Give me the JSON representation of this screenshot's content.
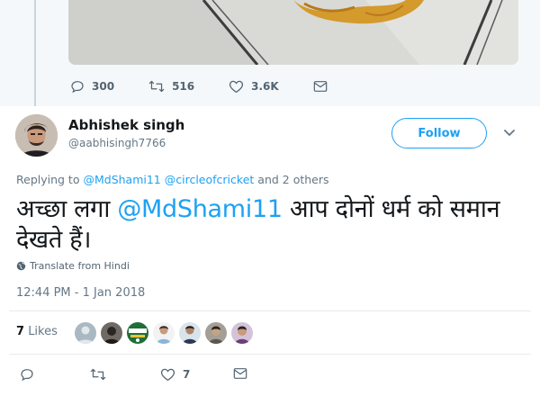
{
  "previous_tweet": {
    "actions": {
      "replies": "300",
      "retweets": "516",
      "likes": "3.6K"
    }
  },
  "tweet": {
    "author_name": "Abhishek singh",
    "author_handle": "@aabhisingh7766",
    "follow_label": "Follow",
    "replying_prefix": "Replying to",
    "reply_to_1": "@MdShami11",
    "reply_to_2": "@circleofcricket",
    "reply_suffix": "and 2 others",
    "text_part1": "अच्छा लगा ",
    "text_mention": "@MdShami11",
    "text_part2": " आप दोनों धर्म को समान देखते हैं।",
    "translate_label": "Translate from Hindi",
    "timestamp": "12:44 PM - 1 Jan 2018",
    "likes_count": "7",
    "likes_label": "Likes",
    "like_action_count": "7"
  },
  "colors": {
    "accent": "#1da1f2",
    "secondary_text": "#657786",
    "background_prev": "#f5f8fa"
  },
  "icons": [
    "reply-icon",
    "retweet-icon",
    "heart-icon",
    "message-icon",
    "globe-icon",
    "chevron-down-icon"
  ]
}
